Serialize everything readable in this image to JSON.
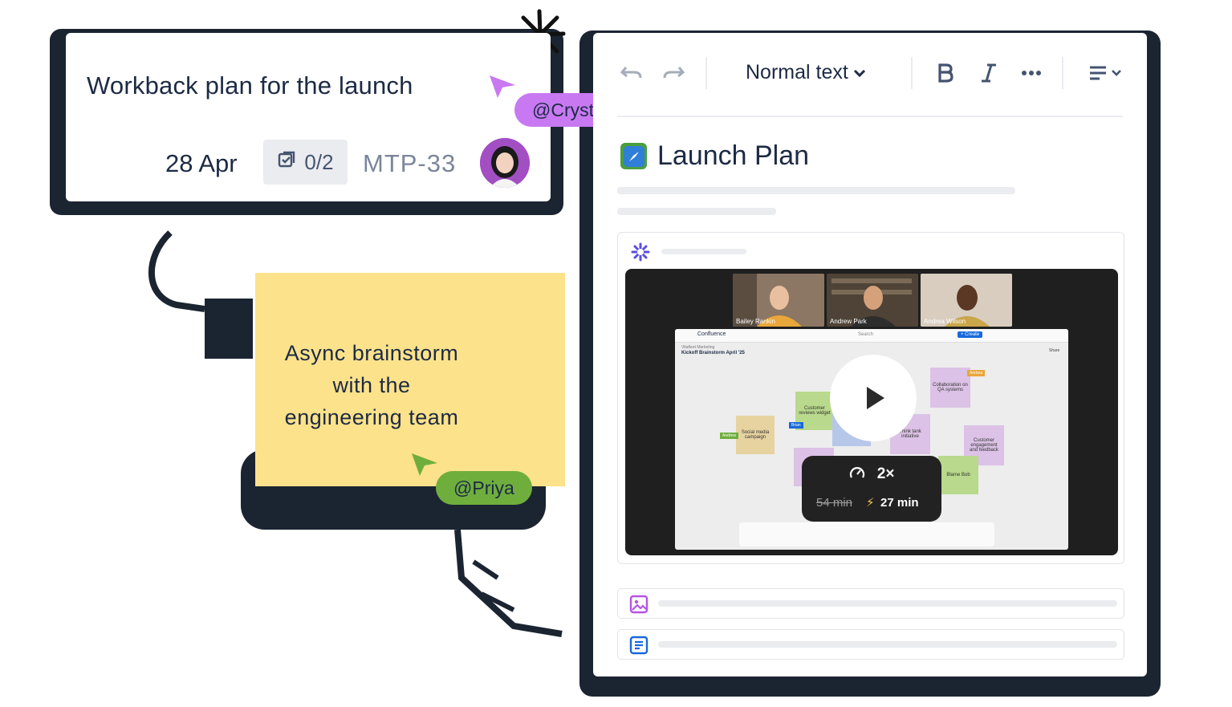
{
  "jira_card": {
    "title": "Workback plan for the launch",
    "due_date": "28 Apr",
    "subtasks": "0/2",
    "issue_key": "MTP-33"
  },
  "cursors": {
    "crystal": {
      "label": "@Crystal",
      "color": "#c879f2"
    },
    "priya": {
      "label": "@Priya",
      "color": "#6fae3d"
    }
  },
  "sticky_note": {
    "lines": [
      "Async brainstorm",
      "with the",
      "engineering team"
    ],
    "color": "#fce28a"
  },
  "editor": {
    "toolbar": {
      "text_style": "Normal text"
    },
    "page_title": "Launch Plan",
    "video": {
      "participants": [
        "Bailey Rankin",
        "Andrew Park",
        "Andrea Wilson"
      ],
      "whiteboard_app": "Confluence",
      "whiteboard_space": "Vitafleet Marketing",
      "whiteboard_title": "Kickoff Brainstorm April '25",
      "create_label": "+ Create",
      "search_label": "Search",
      "share_label": "Share",
      "notes": [
        "Customer reviews widget",
        "Social media campaign",
        "Collaboration on QA systems",
        "Think tank initiative",
        "Customer engagement and feedback",
        "Blame Bob"
      ],
      "name_tags": [
        "Andrew",
        "Brian",
        "Andrea"
      ],
      "playback_rate": "2×",
      "original_duration": "54 min",
      "new_duration": "27 min"
    }
  }
}
